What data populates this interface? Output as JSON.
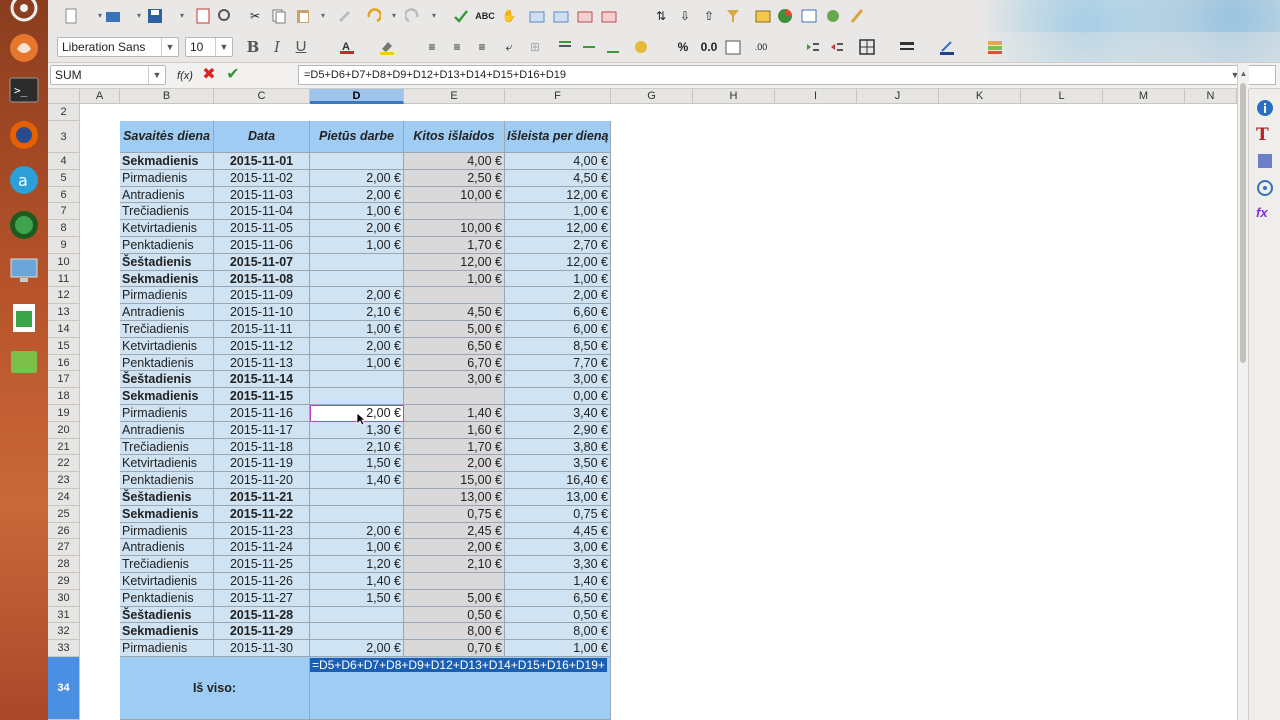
{
  "launcher": [
    "dash-icon",
    "files-icon",
    "terminal-icon",
    "firefox-icon",
    "software-center-icon",
    "web-browser-icon",
    "display-settings-icon",
    "calc-icon",
    "green-app-icon"
  ],
  "toolbar2": {
    "font_name": "Liberation Sans",
    "font_size": "10",
    "number_format_zero": "0.0"
  },
  "formula_bar": {
    "name_box": "SUM",
    "formula": "=D5+D6+D7+D8+D9+D12+D13+D14+D15+D16+D19"
  },
  "columns": [
    "A",
    "B",
    "C",
    "D",
    "E",
    "F",
    "G",
    "H",
    "I",
    "J",
    "K",
    "L",
    "M",
    "N"
  ],
  "selected_column": "D",
  "header_row": {
    "row": "3",
    "b": "Savaitės diena",
    "c": "Data",
    "d": "Pietūs darbe",
    "e": "Kitos išlaidos",
    "f": "Išleista per dieną"
  },
  "rows": [
    {
      "n": "4",
      "b": "Sekmadienis",
      "c": "2015-11-01",
      "d": "",
      "e": "4,00 €",
      "f": "4,00 €",
      "bold": true
    },
    {
      "n": "5",
      "b": "Pirmadienis",
      "c": "2015-11-02",
      "d": "2,00 €",
      "e": "2,50 €",
      "f": "4,50 €",
      "bold": false
    },
    {
      "n": "6",
      "b": "Antradienis",
      "c": "2015-11-03",
      "d": "2,00 €",
      "e": "10,00 €",
      "f": "12,00 €",
      "bold": false
    },
    {
      "n": "7",
      "b": "Trečiadienis",
      "c": "2015-11-04",
      "d": "1,00 €",
      "e": "",
      "f": "1,00 €",
      "bold": false
    },
    {
      "n": "8",
      "b": "Ketvirtadienis",
      "c": "2015-11-05",
      "d": "2,00 €",
      "e": "10,00 €",
      "f": "12,00 €",
      "bold": false
    },
    {
      "n": "9",
      "b": "Penktadienis",
      "c": "2015-11-06",
      "d": "1,00 €",
      "e": "1,70 €",
      "f": "2,70 €",
      "bold": false
    },
    {
      "n": "10",
      "b": "Šeštadienis",
      "c": "2015-11-07",
      "d": "",
      "e": "12,00 €",
      "f": "12,00 €",
      "bold": true
    },
    {
      "n": "11",
      "b": "Sekmadienis",
      "c": "2015-11-08",
      "d": "",
      "e": "1,00 €",
      "f": "1,00 €",
      "bold": true
    },
    {
      "n": "12",
      "b": "Pirmadienis",
      "c": "2015-11-09",
      "d": "2,00 €",
      "e": "",
      "f": "2,00 €",
      "bold": false
    },
    {
      "n": "13",
      "b": "Antradienis",
      "c": "2015-11-10",
      "d": "2,10 €",
      "e": "4,50 €",
      "f": "6,60 €",
      "bold": false
    },
    {
      "n": "14",
      "b": "Trečiadienis",
      "c": "2015-11-11",
      "d": "1,00 €",
      "e": "5,00 €",
      "f": "6,00 €",
      "bold": false
    },
    {
      "n": "15",
      "b": "Ketvirtadienis",
      "c": "2015-11-12",
      "d": "2,00 €",
      "e": "6,50 €",
      "f": "8,50 €",
      "bold": false
    },
    {
      "n": "16",
      "b": "Penktadienis",
      "c": "2015-11-13",
      "d": "1,00 €",
      "e": "6,70 €",
      "f": "7,70 €",
      "bold": false
    },
    {
      "n": "17",
      "b": "Šeštadienis",
      "c": "2015-11-14",
      "d": "",
      "e": "3,00 €",
      "f": "3,00 €",
      "bold": true
    },
    {
      "n": "18",
      "b": "Sekmadienis",
      "c": "2015-11-15",
      "d": "",
      "e": "",
      "f": "0,00 €",
      "bold": true
    },
    {
      "n": "19",
      "b": "Pirmadienis",
      "c": "2015-11-16",
      "d": "2,00 €",
      "e": "1,40 €",
      "f": "3,40 €",
      "bold": false
    },
    {
      "n": "20",
      "b": "Antradienis",
      "c": "2015-11-17",
      "d": "1,30 €",
      "e": "1,60 €",
      "f": "2,90 €",
      "bold": false
    },
    {
      "n": "21",
      "b": "Trečiadienis",
      "c": "2015-11-18",
      "d": "2,10 €",
      "e": "1,70 €",
      "f": "3,80 €",
      "bold": false
    },
    {
      "n": "22",
      "b": "Ketvirtadienis",
      "c": "2015-11-19",
      "d": "1,50 €",
      "e": "2,00 €",
      "f": "3,50 €",
      "bold": false
    },
    {
      "n": "23",
      "b": "Penktadienis",
      "c": "2015-11-20",
      "d": "1,40 €",
      "e": "15,00 €",
      "f": "16,40 €",
      "bold": false
    },
    {
      "n": "24",
      "b": "Šeštadienis",
      "c": "2015-11-21",
      "d": "",
      "e": "13,00 €",
      "f": "13,00 €",
      "bold": true
    },
    {
      "n": "25",
      "b": "Sekmadienis",
      "c": "2015-11-22",
      "d": "",
      "e": "0,75 €",
      "f": "0,75 €",
      "bold": true
    },
    {
      "n": "26",
      "b": "Pirmadienis",
      "c": "2015-11-23",
      "d": "2,00 €",
      "e": "2,45 €",
      "f": "4,45 €",
      "bold": false
    },
    {
      "n": "27",
      "b": "Antradienis",
      "c": "2015-11-24",
      "d": "1,00 €",
      "e": "2,00 €",
      "f": "3,00 €",
      "bold": false
    },
    {
      "n": "28",
      "b": "Trečiadienis",
      "c": "2015-11-25",
      "d": "1,20 €",
      "e": "2,10 €",
      "f": "3,30 €",
      "bold": false
    },
    {
      "n": "29",
      "b": "Ketvirtadienis",
      "c": "2015-11-26",
      "d": "1,40 €",
      "e": "",
      "f": "1,40 €",
      "bold": false
    },
    {
      "n": "30",
      "b": "Penktadienis",
      "c": "2015-11-27",
      "d": "1,50 €",
      "e": "5,00 €",
      "f": "6,50 €",
      "bold": false
    },
    {
      "n": "31",
      "b": "Šeštadienis",
      "c": "2015-11-28",
      "d": "",
      "e": "0,50 €",
      "f": "0,50 €",
      "bold": true
    },
    {
      "n": "32",
      "b": "Sekmadienis",
      "c": "2015-11-29",
      "d": "",
      "e": "8,00 €",
      "f": "8,00 €",
      "bold": true
    },
    {
      "n": "33",
      "b": "Pirmadienis",
      "c": "2015-11-30",
      "d": "2,00 €",
      "e": "0,70 €",
      "f": "1,00 €",
      "bold": false
    }
  ],
  "total_row": {
    "n": "34",
    "label": "Iš viso:",
    "edit_text": "=D5+D6+D7+D8+D9+D12+D13+D14+D15+D16+D19+"
  },
  "row2_label": "2",
  "colors": {
    "header_fill": "#9fccf2",
    "blue_fill": "#cfe3f3",
    "gray_fill": "#d9d9d9",
    "highlight": "#c044c0"
  }
}
